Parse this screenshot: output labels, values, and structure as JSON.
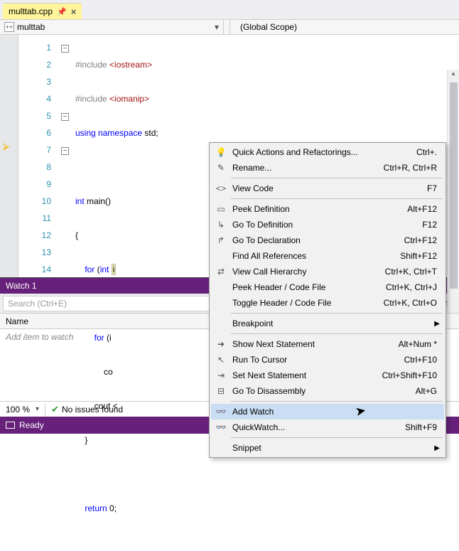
{
  "tab": {
    "filename": "multtab.cpp"
  },
  "nav": {
    "left": "multtab",
    "right": "(Global Scope)"
  },
  "code": {
    "line_numbers": [
      "1",
      "2",
      "3",
      "4",
      "5",
      "6",
      "7",
      "8",
      "9",
      "10",
      "11",
      "12",
      "13",
      "14"
    ],
    "l1_pp": "#include ",
    "l1_inc": "<iostream>",
    "l2_pp": "#include ",
    "l2_inc": "<iomanip>",
    "l3_a": "using",
    "l3_b": " namespace",
    "l3_c": " std;",
    "l5_a": "int",
    "l5_b": " main()",
    "l6": "{",
    "l7_a": "    for",
    "l7_b": " (",
    "l7_c": "int",
    "l7_d": " ",
    "l7_var": "i",
    "l8": "    {",
    "l9_a": "        for",
    "l9_b": " (i",
    "l10": "            co",
    "l11": "        cout <",
    "l12": "    }",
    "l13": "",
    "l14_a": "    return",
    "l14_b": " 0;"
  },
  "watch": {
    "title": "Watch 1",
    "search_placeholder": "Search (Ctrl+E)",
    "col_name": "Name",
    "placeholder": "Add item to watch"
  },
  "status": {
    "zoom": "100 %",
    "no_issues": "No issues found",
    "ready": "Ready"
  },
  "ctx": {
    "items": [
      {
        "icon": "💡",
        "label": "Quick Actions and Refactorings...",
        "sc": "Ctrl+."
      },
      {
        "icon": "✎",
        "label": "Rename...",
        "sc": "Ctrl+R, Ctrl+R"
      },
      {
        "sep": true
      },
      {
        "icon": "<>",
        "label": "View Code",
        "sc": "F7"
      },
      {
        "sep": true
      },
      {
        "icon": "▭",
        "label": "Peek Definition",
        "sc": "Alt+F12"
      },
      {
        "icon": "↳",
        "label": "Go To Definition",
        "sc": "F12"
      },
      {
        "icon": "↱",
        "label": "Go To Declaration",
        "sc": "Ctrl+F12"
      },
      {
        "icon": "",
        "label": "Find All References",
        "sc": "Shift+F12"
      },
      {
        "icon": "⇄",
        "label": "View Call Hierarchy",
        "sc": "Ctrl+K, Ctrl+T"
      },
      {
        "icon": "",
        "label": "Peek Header / Code File",
        "sc": "Ctrl+K, Ctrl+J"
      },
      {
        "icon": "",
        "label": "Toggle Header / Code File",
        "sc": "Ctrl+K, Ctrl+O"
      },
      {
        "sep": true
      },
      {
        "icon": "",
        "label": "Breakpoint",
        "sc": "",
        "sub": true
      },
      {
        "sep": true
      },
      {
        "icon": "➔",
        "label": "Show Next Statement",
        "sc": "Alt+Num *"
      },
      {
        "icon": "↖",
        "label": "Run To Cursor",
        "sc": "Ctrl+F10"
      },
      {
        "icon": "⇥",
        "label": "Set Next Statement",
        "sc": "Ctrl+Shift+F10"
      },
      {
        "icon": "⊟",
        "label": "Go To Disassembly",
        "sc": "Alt+G"
      },
      {
        "sep": true
      },
      {
        "icon": "👓",
        "label": "Add Watch",
        "sc": "",
        "hover": true
      },
      {
        "icon": "👓",
        "label": "QuickWatch...",
        "sc": "Shift+F9"
      },
      {
        "sep": true
      },
      {
        "icon": "",
        "label": "Snippet",
        "sc": "",
        "sub": true
      }
    ]
  }
}
